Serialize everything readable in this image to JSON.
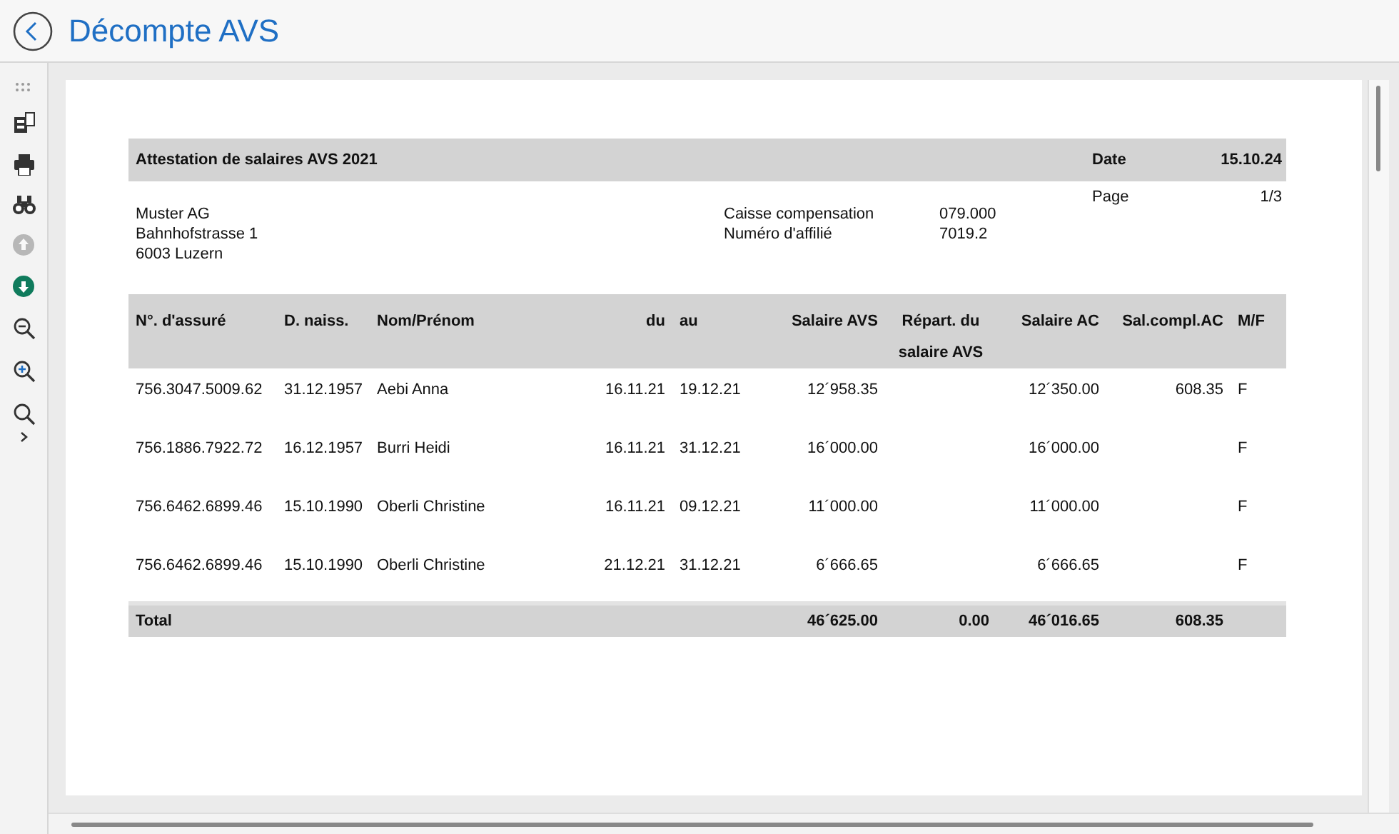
{
  "header": {
    "title": "Décompte AVS"
  },
  "toolbar": [
    {
      "kind": "grip",
      "disabled": false
    },
    {
      "kind": "pages",
      "disabled": false
    },
    {
      "kind": "print",
      "disabled": false
    },
    {
      "kind": "binoculars",
      "disabled": false
    },
    {
      "kind": "up",
      "disabled": true
    },
    {
      "kind": "down",
      "disabled": false
    },
    {
      "kind": "zoom-out",
      "disabled": false
    },
    {
      "kind": "zoom-in",
      "disabled": false
    },
    {
      "kind": "search",
      "disabled": false
    },
    {
      "kind": "expand",
      "disabled": false
    }
  ],
  "report": {
    "title": "Attestation de salaires AVS 2021",
    "date_label": "Date",
    "date": "15.10.24",
    "page_label": "Page",
    "page": "1/3",
    "address": [
      "Muster AG",
      "Bahnhofstrasse 1",
      "6003 Luzern"
    ],
    "fund": [
      {
        "label": "Caisse compensation",
        "value": "079.000"
      },
      {
        "label": "Numéro d'affilié",
        "value": "7019.2"
      }
    ],
    "columns": [
      "N°. d'assuré",
      "D. naiss.",
      "Nom/Prénom",
      "du",
      "au",
      "Salaire AVS",
      "Répart. du salaire AVS",
      "Salaire AC",
      "Sal.compl.AC",
      "M/F"
    ],
    "rows": [
      [
        "756.3047.5009.62",
        "31.12.1957",
        "Aebi Anna",
        "16.11.21",
        "19.12.21",
        "12´958.35",
        null,
        "12´350.00",
        "608.35",
        "F"
      ],
      [
        "756.1886.7922.72",
        "16.12.1957",
        "Burri Heidi",
        "16.11.21",
        "31.12.21",
        "16´000.00",
        null,
        "16´000.00",
        null,
        "F"
      ],
      [
        "756.6462.6899.46",
        "15.10.1990",
        "Oberli Christine",
        "16.11.21",
        "09.12.21",
        "11´000.00",
        null,
        "11´000.00",
        null,
        "F"
      ],
      [
        "756.6462.6899.46",
        "15.10.1990",
        "Oberli Christine",
        "21.12.21",
        "31.12.21",
        "6´666.65",
        null,
        "6´666.65",
        null,
        "F"
      ]
    ],
    "total": {
      "label": "Total",
      "amounts": [
        "46´625.00",
        "0.00",
        "46´016.65",
        "608.35"
      ]
    }
  }
}
